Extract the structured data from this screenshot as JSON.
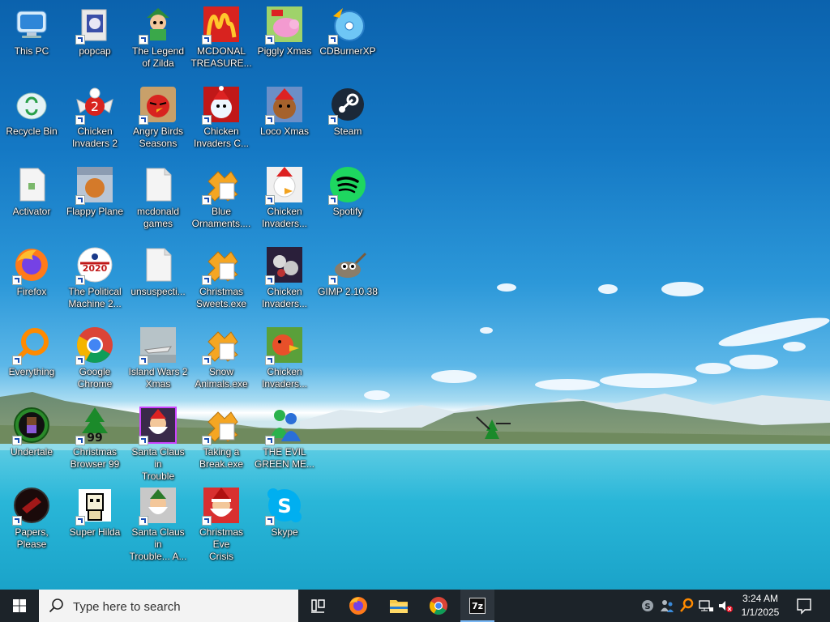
{
  "desktop": {
    "icons": [
      {
        "label": "This PC",
        "icon": "computer-icon"
      },
      {
        "label": "popcap",
        "icon": "folder-icon"
      },
      {
        "label": "The Legend\nof Zilda",
        "icon": "legend-of-zilda-icon"
      },
      {
        "label": "MCDONAL\nTREASURE...",
        "icon": "mcdonalds-icon"
      },
      {
        "label": "Piggly Xmas",
        "icon": "piggly-xmas-icon"
      },
      {
        "label": "CDBurnerXP",
        "icon": "cdburnerxp-icon"
      },
      {
        "label": "Recycle Bin",
        "icon": "recycle-bin-icon"
      },
      {
        "label": "Chicken\nInvaders 2",
        "icon": "chicken-invaders-2-icon"
      },
      {
        "label": "Angry Birds\nSeasons",
        "icon": "angry-birds-seasons-icon"
      },
      {
        "label": "Chicken\nInvaders C...",
        "icon": "chicken-invaders-christmas-icon"
      },
      {
        "label": "Loco Xmas",
        "icon": "loco-xmas-icon"
      },
      {
        "label": "Steam",
        "icon": "steam-icon"
      },
      {
        "label": "Activator",
        "icon": "file-icon"
      },
      {
        "label": "Flappy Plane",
        "icon": "flappy-plane-icon"
      },
      {
        "label": "mcdonald\ngames",
        "icon": "file-icon"
      },
      {
        "label": "Blue\nOrnaments....",
        "icon": "puzzle-exe-icon"
      },
      {
        "label": "Chicken\nInvaders...",
        "icon": "chicken-invaders-icon"
      },
      {
        "label": "Spotify",
        "icon": "spotify-icon"
      },
      {
        "label": "Firefox",
        "icon": "firefox-icon"
      },
      {
        "label": "The Political\nMachine 2...",
        "icon": "political-machine-icon"
      },
      {
        "label": "unsuspecti...",
        "icon": "file-icon"
      },
      {
        "label": "Christmas\nSweets.exe",
        "icon": "puzzle-exe-icon"
      },
      {
        "label": "Chicken\nInvaders...",
        "icon": "chicken-invaders-icon"
      },
      {
        "label": "GIMP 2.10.38",
        "icon": "gimp-icon"
      },
      {
        "label": "Everything",
        "icon": "everything-search-icon"
      },
      {
        "label": "Google\nChrome",
        "icon": "chrome-icon"
      },
      {
        "label": "Island Wars 2\nXmas",
        "icon": "island-wars-icon"
      },
      {
        "label": "Snow\nAnimals.exe",
        "icon": "puzzle-exe-icon"
      },
      {
        "label": "Chicken\nInvaders...",
        "icon": "chicken-invaders-icon"
      },
      {
        "label": "Undertale",
        "icon": "undertale-icon"
      },
      {
        "label": "Christmas\nBrowser 99",
        "icon": "christmas-tree-icon"
      },
      {
        "label": "Santa Claus in\nTrouble",
        "icon": "santa-icon"
      },
      {
        "label": "Taking a\nBreak.exe",
        "icon": "puzzle-exe-icon"
      },
      {
        "label": "THE EVIL\nGREEN ME...",
        "icon": "messenger-icon"
      },
      {
        "label": "Papers, Please",
        "icon": "papers-please-icon"
      },
      {
        "label": "Super Hilda",
        "icon": "super-hilda-icon"
      },
      {
        "label": "Santa Claus in\nTrouble... A...",
        "icon": "santa-icon"
      },
      {
        "label": "Christmas Eve\nCrisis",
        "icon": "santa-icon"
      },
      {
        "label": "Skype",
        "icon": "skype-icon"
      }
    ]
  },
  "taskbar": {
    "search_placeholder": "Type here to search",
    "pinned": [
      {
        "name": "task-view",
        "icon": "task-view-icon"
      },
      {
        "name": "firefox",
        "icon": "firefox-icon"
      },
      {
        "name": "file-explorer",
        "icon": "folder-icon"
      },
      {
        "name": "chrome",
        "icon": "chrome-icon"
      },
      {
        "name": "7zip",
        "icon": "7zip-icon",
        "text": "7z"
      }
    ],
    "tray": {
      "time": "3:24 AM",
      "date": "1/1/2025"
    }
  },
  "colors": {
    "taskbar": "#1c2329",
    "accent": "#0078d7"
  }
}
